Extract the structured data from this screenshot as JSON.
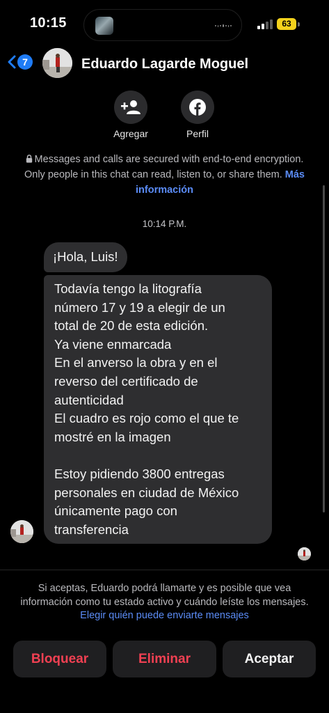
{
  "status_bar": {
    "time": "10:15",
    "battery_level": "63",
    "signal_bars": 2,
    "now_playing_icon": "audio-waveform-icon"
  },
  "header": {
    "back_count": "7",
    "contact_name": "Eduardo Lagarde Moguel"
  },
  "actions": {
    "add_label": "Agregar",
    "profile_label": "Perfil"
  },
  "encryption_notice": {
    "text": "Messages and calls are secured with end-to-end encryption. Only people in this chat can read, listen to, or share them.",
    "link": "Más información"
  },
  "timestamp": "10:14 P.M.",
  "messages": [
    {
      "text": "¡Hola, Luis!"
    },
    {
      "lines": [
        "Todavía tengo la litografía",
        "número 17 y 19 a elegir de un",
        "total de 20 de esta edición.",
        "Ya viene enmarcada",
        "En el anverso la obra y en el",
        "reverso del certificado de",
        "autenticidad",
        "El cuadro es rojo como el que te",
        "mostré en la imagen",
        "",
        "Estoy pidiendo 3800 entregas",
        "personales en ciudad de México",
        "únicamente pago con",
        "transferencia"
      ]
    }
  ],
  "request_info": {
    "text": "Si aceptas, Eduardo podrá llamarte y es posible que vea información como tu estado activo y cuándo leíste los mensajes.",
    "link": "Elegir quién puede enviarte mensajes"
  },
  "buttons": {
    "block": "Bloquear",
    "delete": "Eliminar",
    "accept": "Aceptar"
  },
  "colors": {
    "background": "#000000",
    "bubble": "#2e2e30",
    "link": "#5b8cf7",
    "accent_blue": "#1f7cf6",
    "danger": "#f04052",
    "battery": "#f4d21c"
  }
}
